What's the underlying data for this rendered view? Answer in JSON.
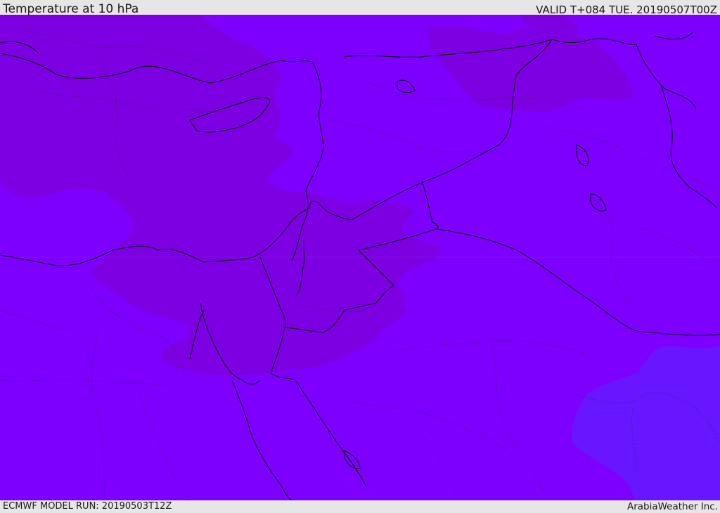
{
  "header": {
    "title": "Temperature at 10 hPa",
    "valid_time": "VALID T+084 TUE. 20190507T00Z"
  },
  "footer": {
    "model_run": "ECMWF MODEL RUN: 20190503T12Z",
    "credit": "ArabiaWeather Inc."
  },
  "map": {
    "field": "Temperature",
    "level": "10 hPa",
    "colors": {
      "background_fill": "#7d00ff",
      "warm_band_fill": "#7c00e2",
      "cool_band_fill": "#6816ff",
      "border_line": "#000000",
      "province_line": "#3a1a66"
    }
  }
}
